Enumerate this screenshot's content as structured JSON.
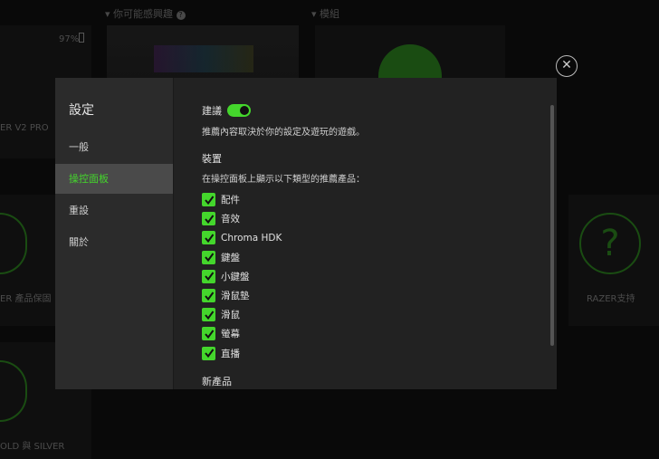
{
  "background": {
    "sections": [
      "你可能感興趣",
      "模組"
    ],
    "battery": "97%",
    "device_name": "ER V2 PRO",
    "tiles": [
      "ER 產品保固",
      "RAZER支持",
      "OLD 與 SILVER"
    ]
  },
  "settings": {
    "title": "設定",
    "nav": [
      {
        "label": "一般"
      },
      {
        "label": "操控面板"
      },
      {
        "label": "重設"
      },
      {
        "label": "關於"
      }
    ],
    "suggest_label": "建議",
    "suggest_on": true,
    "suggest_desc": "推薦內容取決於你的設定及遊玩的遊戲。",
    "devices_heading": "裝置",
    "devices_desc": "在操控面板上顯示以下類型的推薦產品：",
    "items": [
      {
        "label": "配件"
      },
      {
        "label": "音效"
      },
      {
        "label": "Chroma HDK"
      },
      {
        "label": "鍵盤"
      },
      {
        "label": "小鍵盤"
      },
      {
        "label": "滑鼠墊"
      },
      {
        "label": "滑鼠"
      },
      {
        "label": "螢幕"
      },
      {
        "label": "直播"
      }
    ],
    "next_heading": "新產品"
  },
  "colors": {
    "accent": "#44d62c"
  }
}
